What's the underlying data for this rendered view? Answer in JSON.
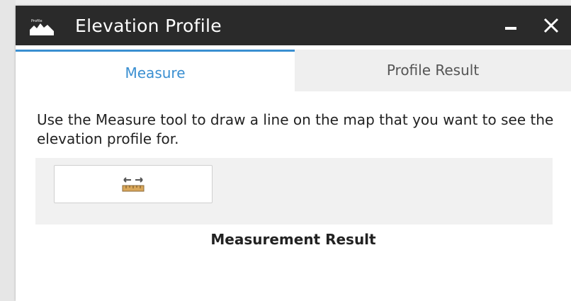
{
  "window": {
    "title": "Elevation Profile",
    "icon": "mountain-profile-icon",
    "icon_caption": "Profile",
    "titlebar_color": "#2a2a2a"
  },
  "tabs": [
    {
      "label": "Measure",
      "active": true
    },
    {
      "label": "Profile Result",
      "active": false
    }
  ],
  "accent_color": "#3a8fd1",
  "instructions": "Use the Measure tool to draw a line on the map that you want to see the elevation profile for.",
  "tools": {
    "measure_button_icon": "measure-distance-icon"
  },
  "result": {
    "heading": "Measurement Result"
  }
}
